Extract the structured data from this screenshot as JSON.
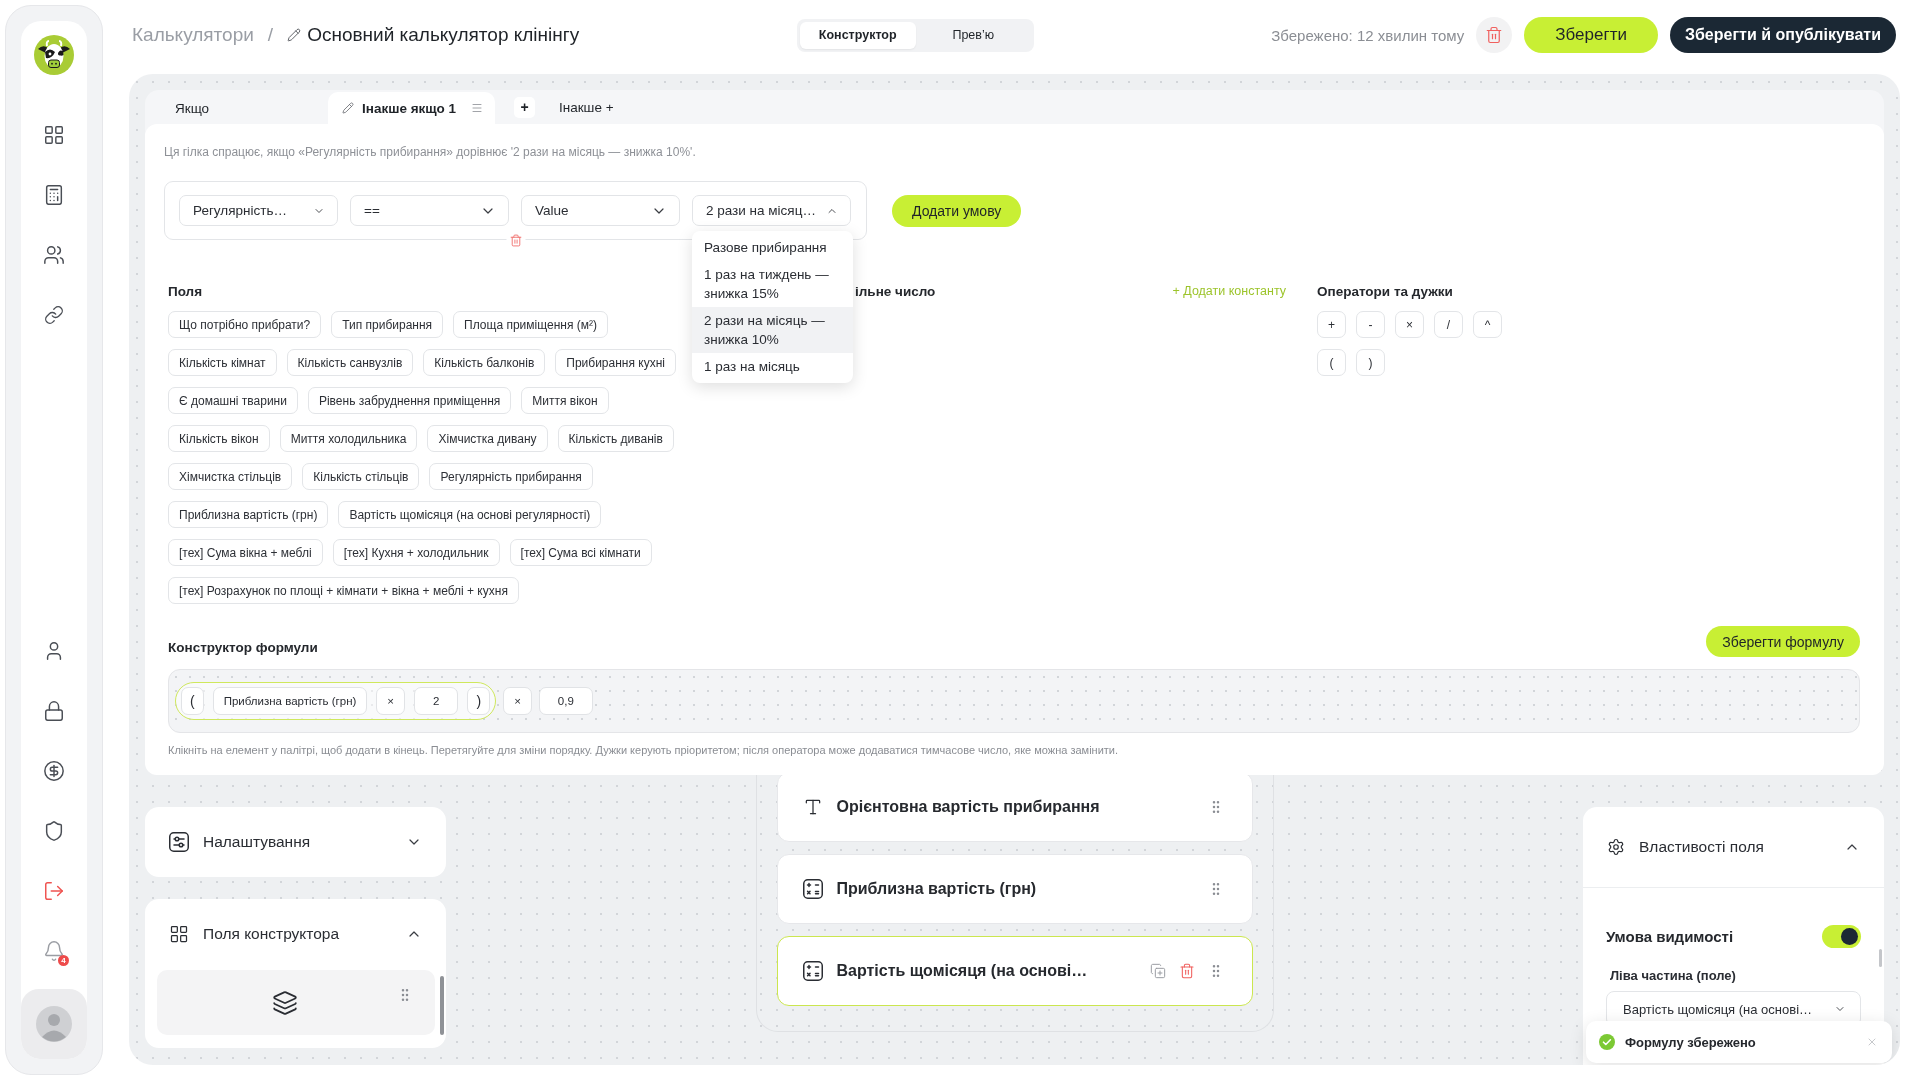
{
  "sidebar": {
    "notification_count": "4"
  },
  "breadcrumb": {
    "parent": "Калькулятори",
    "separator": "/",
    "title": "Основний калькулятор клінінгу"
  },
  "mode_tabs": [
    {
      "label": "Конструктор",
      "selected": true
    },
    {
      "label": "Прев’ю",
      "selected": false
    }
  ],
  "save_status": "Збережено: 12 хвилин тому",
  "save_button": "Зберегти",
  "publish_button": "Зберегти й опублікувати",
  "branch_tabs": [
    {
      "label": "Якщо",
      "selected": false
    },
    {
      "label": "Інакше якщо 1",
      "selected": true
    }
  ],
  "add_branch_button": "+",
  "else_button": "Інакше +",
  "branch_hint": "Ця гілка спрацює, якщо «Регулярність прибирання» дорівнює '2 рази на місяць — знижка 10%'.",
  "condition": {
    "selects": [
      {
        "value": "Регулярність…",
        "open": false
      },
      {
        "value": "==",
        "open": false
      },
      {
        "value": "Value",
        "open": false
      },
      {
        "value": "2 рази на місяц…",
        "open": true,
        "options": [
          {
            "label": "Разове прибирання",
            "selected": false
          },
          {
            "label": "1 раз на тиждень — знижка 15%",
            "selected": false
          },
          {
            "label": "2 рази на місяць — знижка 10%",
            "selected": true
          },
          {
            "label": "1 раз на місяць",
            "selected": false
          }
        ]
      }
    ]
  },
  "add_condition_button": "Додати умову",
  "palette": {
    "fields_title": "Поля",
    "field_rows": [
      [
        "Що потрібно прибрати?",
        "Тип прибирання",
        "Площа приміщення (м²)"
      ],
      [
        "Кількість кімнат",
        "Кількість санвузлів",
        "Кількість балконів",
        "Прибирання кухні"
      ],
      [
        "Є домашні тварини",
        "Рівень забруднення приміщення",
        "Миття вікон"
      ],
      [
        "Кількість вікон",
        "Миття холодильника",
        "Хімчистка дивану",
        "Кількість диванів"
      ],
      [
        "Хімчистка стільців",
        "Кількість стільців",
        "Регулярність прибирання"
      ],
      [
        "Приблизна вартість (грн)",
        "Вартість щомісяця (на основі регулярності)"
      ],
      [
        "[тех] Сума вікна + меблі",
        "[тех] Кухня + холодильник",
        "[тех] Сума всі кімнати"
      ],
      [
        "[тех] Розрахунок по площі + кімнати + вікна + меблі + кухня"
      ]
    ],
    "number_title": "ільне число",
    "add_constant_link": "+ Додати константу",
    "operators_title": "Оператори та дужки",
    "operator_rows": [
      [
        "+",
        "-",
        "×",
        "/",
        "^"
      ],
      [
        "(",
        ")"
      ]
    ]
  },
  "formula": {
    "title": "Конструктор формули",
    "save_button": "Зберегти формулу",
    "tokens": [
      {
        "kind": "group",
        "children": [
          {
            "kind": "paren",
            "text": "("
          },
          {
            "kind": "field",
            "text": "Приблизна вартість (грн)"
          },
          {
            "kind": "operator",
            "text": "×"
          },
          {
            "kind": "number",
            "text": "2"
          },
          {
            "kind": "paren",
            "text": ")"
          }
        ]
      },
      {
        "kind": "operator",
        "text": "×"
      },
      {
        "kind": "number",
        "text": "0,9"
      }
    ],
    "help": "Клікніть на елемент у палітрі, щоб додати в кінець. Перетягуйте для зміни порядку. Дужки керують пріоритетом; після оператора може додаватися тимчасове число, яке можна замінити."
  },
  "settings_panel": {
    "title": "Налаштування",
    "expanded": false
  },
  "builder_fields_panel": {
    "title": "Поля конструктора",
    "expanded": true
  },
  "canvas_fields": [
    {
      "kind": "text",
      "label": "Орієнтовна вартість прибирання",
      "selected": false
    },
    {
      "kind": "calculation",
      "label": "Приблизна вартість (грн)",
      "selected": false
    },
    {
      "kind": "calculation",
      "label": "Вартість щомісяця (на основі…",
      "selected": true
    }
  ],
  "properties_panel": {
    "title": "Властивості поля",
    "expanded": true,
    "visibility_condition": {
      "label": "Умова видимості",
      "on": true
    },
    "left_operand": {
      "label": "Ліва частина (поле)",
      "value": "Вартість щомісяця (на основі…"
    }
  },
  "toast": {
    "message": "Формулу збережено"
  }
}
